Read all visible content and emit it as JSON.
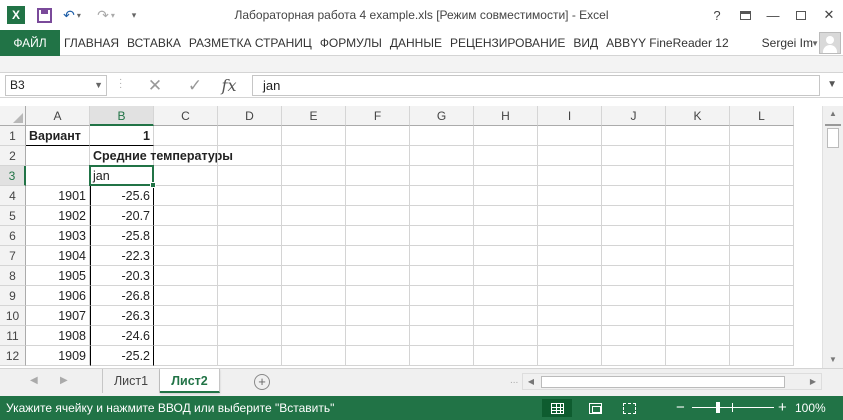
{
  "window": {
    "title": "Лабораторная работа 4 example.xls  [Режим совместимости] - Excel",
    "help_icon": "?",
    "app_icon": "excel-logo",
    "app_letter": "X"
  },
  "ribbon": {
    "file_tab": "ФАЙЛ",
    "tabs": [
      "ГЛАВНАЯ",
      "ВСТАВКА",
      "РАЗМЕТКА СТРАНИЦ",
      "ФОРМУЛЫ",
      "ДАННЫЕ",
      "РЕЦЕНЗИРОВАНИЕ",
      "ВИД",
      "ABBYY FineReader 12"
    ],
    "user": "Sergei Im"
  },
  "formula_bar": {
    "name_box": "B3",
    "fx_label": "fx",
    "formula": "jan"
  },
  "grid": {
    "columns": [
      "A",
      "B",
      "C",
      "D",
      "E",
      "F",
      "G",
      "H",
      "I",
      "J",
      "K",
      "L"
    ],
    "rows": [
      "1",
      "2",
      "3",
      "4",
      "5",
      "6",
      "7",
      "8",
      "9",
      "10",
      "11",
      "12"
    ],
    "selected_cell": "B3",
    "cells": {
      "A1": "Вариант",
      "B1": "1",
      "B2": "Средние температуры",
      "B3": "jan",
      "A4": "1901",
      "B4": "-25.6",
      "A5": "1902",
      "B5": "-20.7",
      "A6": "1903",
      "B6": "-25.8",
      "A7": "1904",
      "B7": "-22.3",
      "A8": "1905",
      "B8": "-20.3",
      "A9": "1906",
      "B9": "-26.8",
      "A10": "1907",
      "B10": "-26.3",
      "A11": "1908",
      "B11": "-24.6",
      "A12": "1909",
      "B12": "-25.2"
    }
  },
  "sheets": {
    "tabs": [
      "Лист1",
      "Лист2"
    ],
    "active": "Лист2",
    "add_label": "+",
    "more_label": "..."
  },
  "status_bar": {
    "message": "Укажите ячейку и нажмите ВВОД или выберите \"Вставить\"",
    "zoom_minus": "−",
    "zoom_plus": "+",
    "zoom": "100%",
    "zoom_fraction": 1.0
  },
  "colors": {
    "accent": "#217346",
    "status_bar": "#217346"
  }
}
